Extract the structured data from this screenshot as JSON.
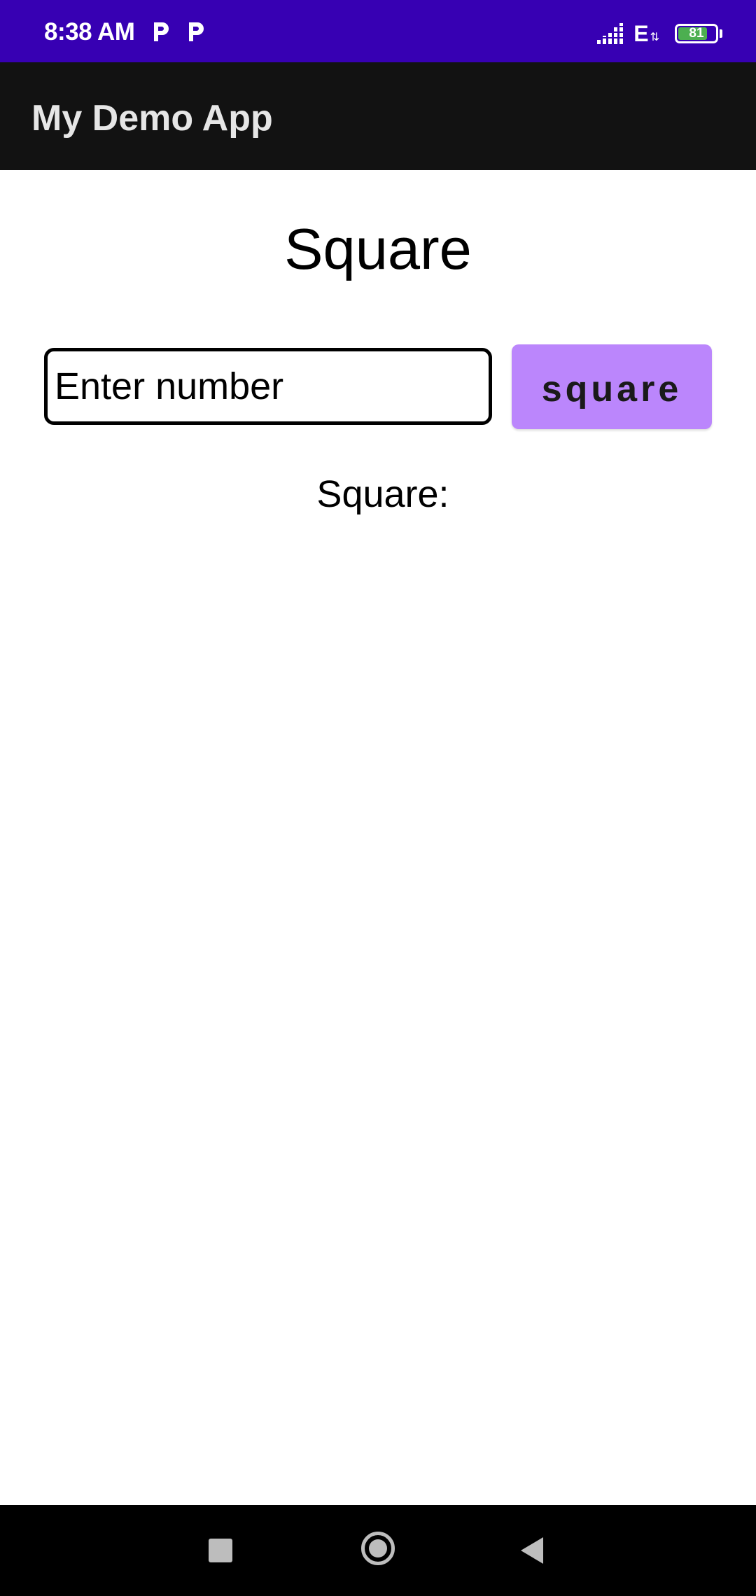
{
  "status_bar": {
    "time": "8:38 AM",
    "notification_icons": [
      "p-notification-icon",
      "p-notification-icon"
    ],
    "signal_icon": "signal-bars-icon",
    "network_type": "E",
    "network_arrows": "⇅",
    "battery_level": "81",
    "battery_fraction": 0.81,
    "background_color": "#3700b3"
  },
  "app_bar": {
    "title": "My Demo App",
    "background_color": "#121212"
  },
  "main": {
    "heading": "Square",
    "number_input": {
      "value": "",
      "placeholder": "Enter number"
    },
    "square_button_label": "square",
    "square_button_color": "#bb86fc",
    "result_label": "Square:"
  },
  "nav_bar": {
    "recent_icon": "square-recents-icon",
    "home_icon": "circle-home-icon",
    "back_icon": "triangle-back-icon"
  }
}
